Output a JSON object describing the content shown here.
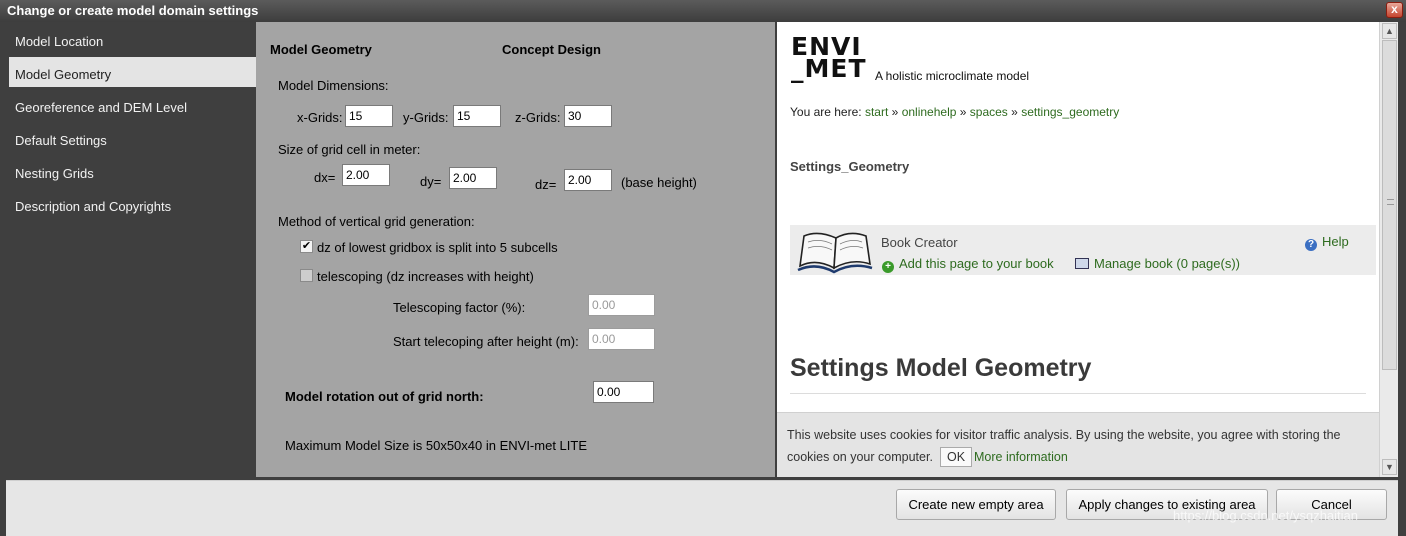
{
  "window": {
    "title": "Change or create model domain settings",
    "close_label": "x"
  },
  "sidebar": {
    "items": [
      {
        "label": "Model Location"
      },
      {
        "label": "Model Geometry"
      },
      {
        "label": "Georeference and DEM Level"
      },
      {
        "label": "Default Settings"
      },
      {
        "label": "Nesting Grids"
      },
      {
        "label": "Description and Copyrights"
      }
    ],
    "active_index": 1
  },
  "form": {
    "heading": "Model Geometry",
    "subheading": "Concept Design",
    "dimensions_label": "Model Dimensions:",
    "xgrids_label": "x-Grids:",
    "xgrids_value": "15",
    "ygrids_label": "y-Grids:",
    "ygrids_value": "15",
    "zgrids_label": "z-Grids:",
    "zgrids_value": "30",
    "cell_size_label": "Size of grid cell in meter:",
    "dx_label": "dx=",
    "dx_value": "2.00",
    "dy_label": "dy=",
    "dy_value": "2.00",
    "dz_label": "dz=",
    "dz_value": "2.00",
    "dz_suffix": "(base height)",
    "vertical_method_label": "Method of vertical grid generation:",
    "split_checkbox_label": "dz of lowest gridbox is split into 5 subcells",
    "split_checked": true,
    "telescoping_checkbox_label": "telescoping (dz increases with height)",
    "telescoping_checked": false,
    "telescoping_factor_label": "Telescoping factor (%):",
    "telescoping_factor_value": "0.00",
    "start_telescoping_label": "Start telecoping after height (m):",
    "start_telescoping_value": "0.00",
    "rotation_label": "Model rotation out of grid north:",
    "rotation_value": "0.00",
    "max_size_note": "Maximum Model Size is 50x50x40 in ENVI-met LITE"
  },
  "help": {
    "logo_line1": "ENVI",
    "logo_line2": "_MET",
    "tagline": "A holistic microclimate model",
    "breadcrumb_prefix": "You are here:",
    "breadcrumbs": [
      "start",
      "onlinehelp",
      "spaces",
      "settings_geometry"
    ],
    "breadcrumb_sep": "»",
    "page_id": "Settings_Geometry",
    "book_creator_title": "Book Creator",
    "add_page_label": "Add this page to your book",
    "manage_book_label": "Manage book (0 page(s))",
    "help_label": "Help",
    "heading": "Settings Model Geometry",
    "cookie_text_line1": "This website uses cookies for visitor traffic analysis. By using the website, you agree with storing the",
    "cookie_text_line2": "cookies on your computer.",
    "cookie_ok_label": "OK",
    "cookie_more_label": "More information"
  },
  "buttons": {
    "create_new": "Create new empty area",
    "apply_changes": "Apply changes to existing area",
    "cancel": "Cancel"
  },
  "watermark": "https://blog.csdn.net/ysqzhaitian",
  "colors": {
    "sidebar_bg": "#3f3f3f",
    "form_bg": "#a4a4a4",
    "link_green": "#2e6b1f"
  }
}
